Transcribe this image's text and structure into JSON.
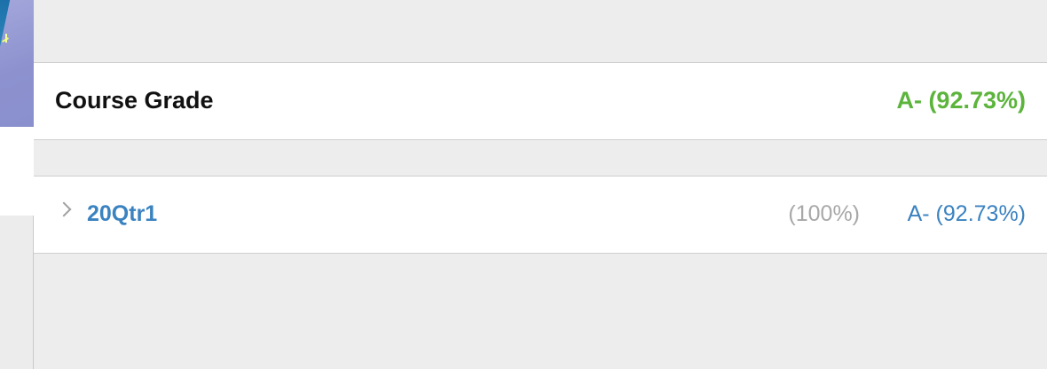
{
  "course": {
    "title": "Course Grade",
    "grade": "A- (92.73%)"
  },
  "terms": [
    {
      "name": "20Qtr1",
      "weight": "(100%)",
      "grade": "A- (92.73%)"
    }
  ],
  "colors": {
    "course_grade": "#5cb43c",
    "term_link": "#3a82c0",
    "muted": "#a8a8a8",
    "background": "#ededed"
  },
  "icons": {
    "expand": "chevron-right-icon"
  }
}
